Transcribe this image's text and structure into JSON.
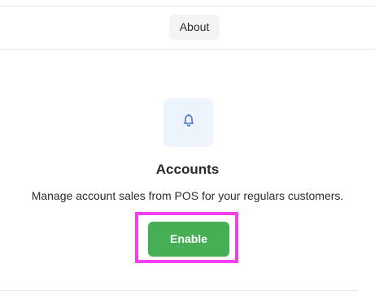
{
  "tabs": {
    "about_label": "About"
  },
  "feature": {
    "icon": "bell-icon",
    "title": "Accounts",
    "description": "Manage account sales from POS for your regulars customers.",
    "enable_label": "Enable"
  },
  "colors": {
    "accent_green": "#46af55",
    "icon_blue": "#4a78d0",
    "highlight_magenta": "#f43ef1",
    "icon_tile_bg": "#eef4fb"
  }
}
